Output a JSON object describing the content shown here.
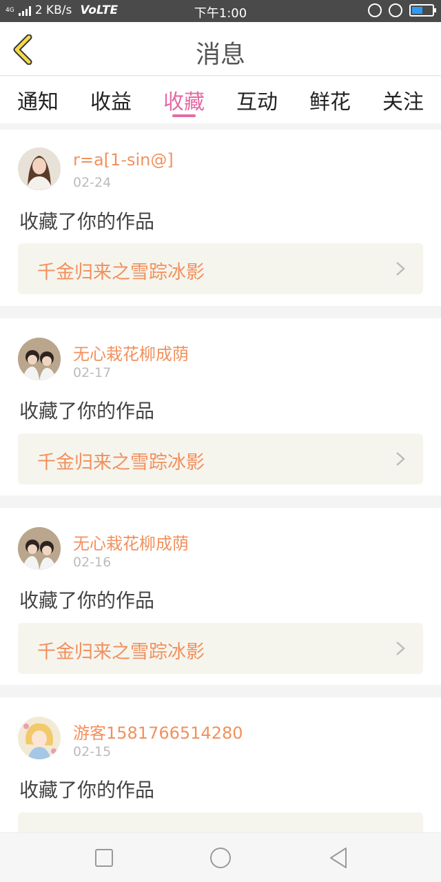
{
  "status_bar": {
    "network": "4G",
    "speed": "2 KB/s",
    "volte": "VoLTE",
    "time": "下午1:00",
    "battery_level": 0.55,
    "battery_color": "#2f9bf4"
  },
  "header": {
    "title": "消息",
    "back_icon": "back-chevron-icon"
  },
  "tabs": [
    {
      "label": "通知",
      "active": false
    },
    {
      "label": "收益",
      "active": false
    },
    {
      "label": "收藏",
      "active": true
    },
    {
      "label": "互动",
      "active": false
    },
    {
      "label": "鲜花",
      "active": false
    },
    {
      "label": "关注",
      "active": false
    }
  ],
  "colors": {
    "accent": "#e56aa4",
    "username": "#f2905d",
    "work_bg": "#f5f5ee"
  },
  "messages": [
    {
      "username": "r=a[1-sin@]",
      "date": "02-24",
      "action": "收藏了你的作品",
      "work_title": "千金归来之雪踪冰影"
    },
    {
      "username": "无心栽花柳成荫",
      "date": "02-17",
      "action": "收藏了你的作品",
      "work_title": "千金归来之雪踪冰影"
    },
    {
      "username": "无心栽花柳成荫",
      "date": "02-16",
      "action": "收藏了你的作品",
      "work_title": "千金归来之雪踪冰影"
    },
    {
      "username": "游客1581766514280",
      "date": "02-15",
      "action": "收藏了你的作品",
      "work_title": ""
    }
  ],
  "navbar": {
    "icons": [
      "recent-apps-icon",
      "home-icon",
      "back-icon"
    ]
  }
}
